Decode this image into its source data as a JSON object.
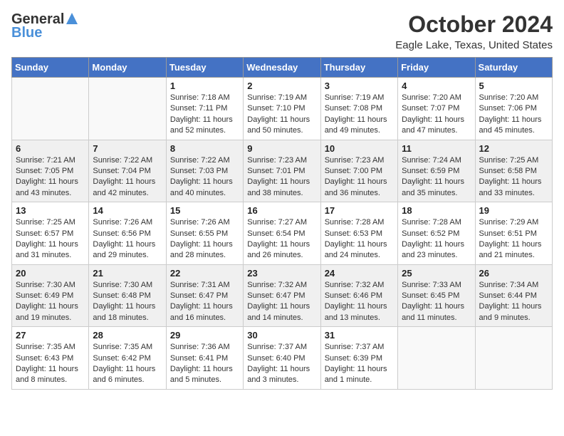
{
  "header": {
    "logo_general": "General",
    "logo_blue": "Blue",
    "month_title": "October 2024",
    "location": "Eagle Lake, Texas, United States"
  },
  "days_of_week": [
    "Sunday",
    "Monday",
    "Tuesday",
    "Wednesday",
    "Thursday",
    "Friday",
    "Saturday"
  ],
  "weeks": [
    [
      {
        "day": "",
        "info": ""
      },
      {
        "day": "",
        "info": ""
      },
      {
        "day": "1",
        "info": "Sunrise: 7:18 AM\nSunset: 7:11 PM\nDaylight: 11 hours and 52 minutes."
      },
      {
        "day": "2",
        "info": "Sunrise: 7:19 AM\nSunset: 7:10 PM\nDaylight: 11 hours and 50 minutes."
      },
      {
        "day": "3",
        "info": "Sunrise: 7:19 AM\nSunset: 7:08 PM\nDaylight: 11 hours and 49 minutes."
      },
      {
        "day": "4",
        "info": "Sunrise: 7:20 AM\nSunset: 7:07 PM\nDaylight: 11 hours and 47 minutes."
      },
      {
        "day": "5",
        "info": "Sunrise: 7:20 AM\nSunset: 7:06 PM\nDaylight: 11 hours and 45 minutes."
      }
    ],
    [
      {
        "day": "6",
        "info": "Sunrise: 7:21 AM\nSunset: 7:05 PM\nDaylight: 11 hours and 43 minutes."
      },
      {
        "day": "7",
        "info": "Sunrise: 7:22 AM\nSunset: 7:04 PM\nDaylight: 11 hours and 42 minutes."
      },
      {
        "day": "8",
        "info": "Sunrise: 7:22 AM\nSunset: 7:03 PM\nDaylight: 11 hours and 40 minutes."
      },
      {
        "day": "9",
        "info": "Sunrise: 7:23 AM\nSunset: 7:01 PM\nDaylight: 11 hours and 38 minutes."
      },
      {
        "day": "10",
        "info": "Sunrise: 7:23 AM\nSunset: 7:00 PM\nDaylight: 11 hours and 36 minutes."
      },
      {
        "day": "11",
        "info": "Sunrise: 7:24 AM\nSunset: 6:59 PM\nDaylight: 11 hours and 35 minutes."
      },
      {
        "day": "12",
        "info": "Sunrise: 7:25 AM\nSunset: 6:58 PM\nDaylight: 11 hours and 33 minutes."
      }
    ],
    [
      {
        "day": "13",
        "info": "Sunrise: 7:25 AM\nSunset: 6:57 PM\nDaylight: 11 hours and 31 minutes."
      },
      {
        "day": "14",
        "info": "Sunrise: 7:26 AM\nSunset: 6:56 PM\nDaylight: 11 hours and 29 minutes."
      },
      {
        "day": "15",
        "info": "Sunrise: 7:26 AM\nSunset: 6:55 PM\nDaylight: 11 hours and 28 minutes."
      },
      {
        "day": "16",
        "info": "Sunrise: 7:27 AM\nSunset: 6:54 PM\nDaylight: 11 hours and 26 minutes."
      },
      {
        "day": "17",
        "info": "Sunrise: 7:28 AM\nSunset: 6:53 PM\nDaylight: 11 hours and 24 minutes."
      },
      {
        "day": "18",
        "info": "Sunrise: 7:28 AM\nSunset: 6:52 PM\nDaylight: 11 hours and 23 minutes."
      },
      {
        "day": "19",
        "info": "Sunrise: 7:29 AM\nSunset: 6:51 PM\nDaylight: 11 hours and 21 minutes."
      }
    ],
    [
      {
        "day": "20",
        "info": "Sunrise: 7:30 AM\nSunset: 6:49 PM\nDaylight: 11 hours and 19 minutes."
      },
      {
        "day": "21",
        "info": "Sunrise: 7:30 AM\nSunset: 6:48 PM\nDaylight: 11 hours and 18 minutes."
      },
      {
        "day": "22",
        "info": "Sunrise: 7:31 AM\nSunset: 6:47 PM\nDaylight: 11 hours and 16 minutes."
      },
      {
        "day": "23",
        "info": "Sunrise: 7:32 AM\nSunset: 6:47 PM\nDaylight: 11 hours and 14 minutes."
      },
      {
        "day": "24",
        "info": "Sunrise: 7:32 AM\nSunset: 6:46 PM\nDaylight: 11 hours and 13 minutes."
      },
      {
        "day": "25",
        "info": "Sunrise: 7:33 AM\nSunset: 6:45 PM\nDaylight: 11 hours and 11 minutes."
      },
      {
        "day": "26",
        "info": "Sunrise: 7:34 AM\nSunset: 6:44 PM\nDaylight: 11 hours and 9 minutes."
      }
    ],
    [
      {
        "day": "27",
        "info": "Sunrise: 7:35 AM\nSunset: 6:43 PM\nDaylight: 11 hours and 8 minutes."
      },
      {
        "day": "28",
        "info": "Sunrise: 7:35 AM\nSunset: 6:42 PM\nDaylight: 11 hours and 6 minutes."
      },
      {
        "day": "29",
        "info": "Sunrise: 7:36 AM\nSunset: 6:41 PM\nDaylight: 11 hours and 5 minutes."
      },
      {
        "day": "30",
        "info": "Sunrise: 7:37 AM\nSunset: 6:40 PM\nDaylight: 11 hours and 3 minutes."
      },
      {
        "day": "31",
        "info": "Sunrise: 7:37 AM\nSunset: 6:39 PM\nDaylight: 11 hours and 1 minute."
      },
      {
        "day": "",
        "info": ""
      },
      {
        "day": "",
        "info": ""
      }
    ]
  ]
}
